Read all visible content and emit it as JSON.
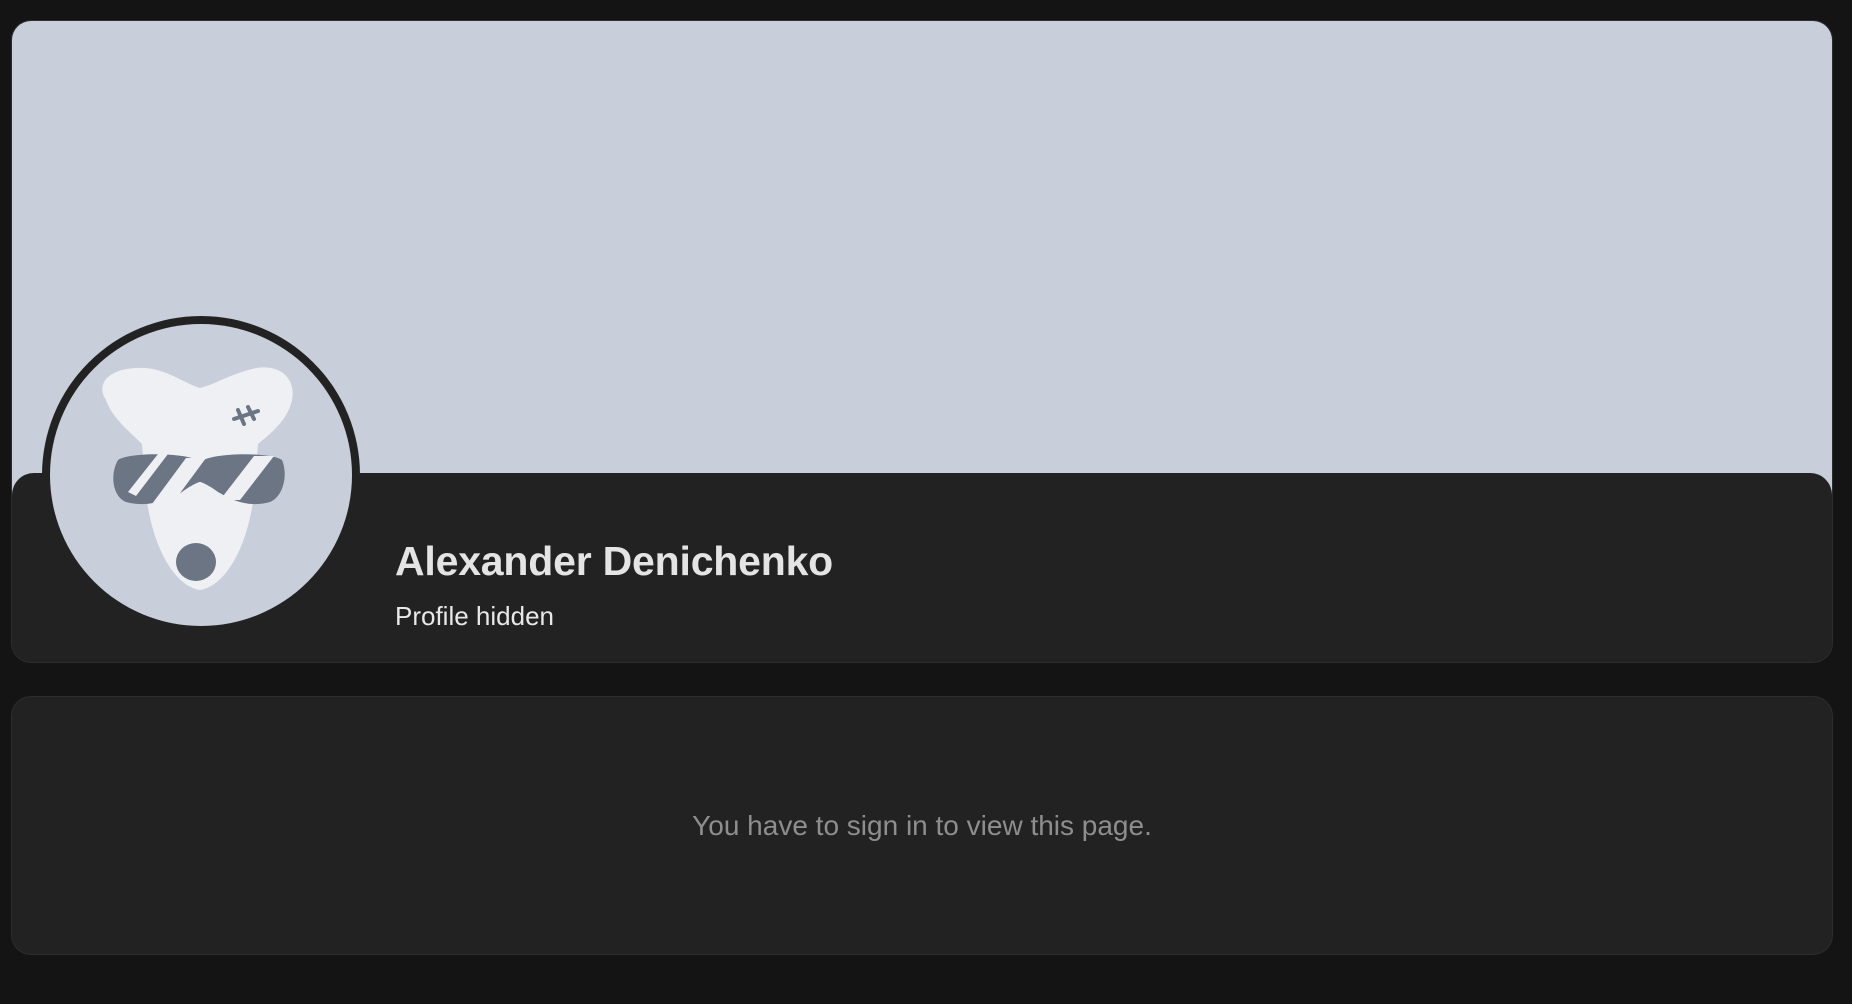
{
  "profile": {
    "name": "Alexander Denichenko",
    "status": "Profile hidden",
    "avatar_icon": "deactivated-dog-avatar-icon",
    "cover_color": "#c8ceda"
  },
  "notice": {
    "message": "You have to sign in to view this page."
  },
  "colors": {
    "page_background": "#141414",
    "card_background": "#222222",
    "avatar_background": "#c8ceda",
    "avatar_face": "#eff0f3",
    "avatar_detail": "#6b7583",
    "name_text": "#e4e4e4",
    "notice_text": "#8e8e8e"
  }
}
